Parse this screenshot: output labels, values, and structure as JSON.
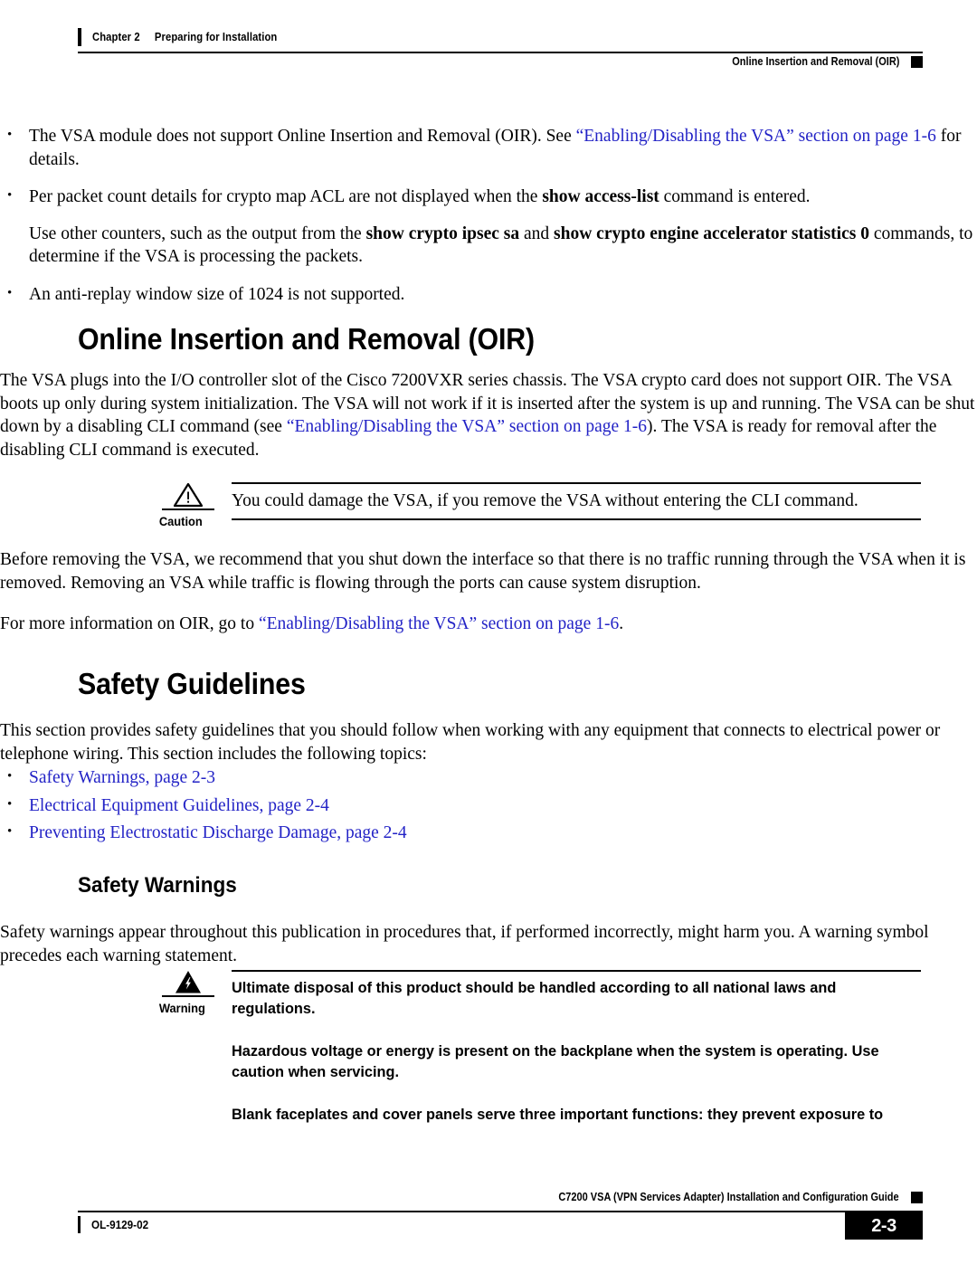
{
  "header": {
    "chapter_number": "Chapter 2",
    "chapter_title": "Preparing for Installation",
    "section_title": "Online Insertion and Removal (OIR)"
  },
  "colors": {
    "link": "#2323c6",
    "text": "#000000",
    "page_background": "#ffffff"
  },
  "intro_bullets": [
    {
      "pre": "The VSA module does not support Online Insertion and Removal (OIR). See ",
      "link": "“Enabling/Disabling the VSA” section on page 1-6",
      "post": " for details."
    }
  ],
  "bullet2": {
    "part1": "Per packet count details for crypto map ACL are not displayed when the ",
    "bold1": "show access-list",
    "part2": " command is entered.",
    "sub_part1": "Use other counters, such as the output from the ",
    "sub_bold1": "show crypto ipsec sa",
    "sub_part2": " and ",
    "sub_bold2": "show crypto engine accelerator statistics 0",
    "sub_part3": " commands, to determine if the VSA is processing the packets."
  },
  "bullet3": {
    "text": "An anti-replay window size of 1024 is not supported."
  },
  "oir_section": {
    "heading": "Online Insertion and Removal (OIR)",
    "para1_part1": "The VSA plugs into the I/O controller slot of the Cisco 7200VXR series chassis. The VSA crypto card does not support OIR. The VSA boots up only during system initialization. The VSA will not work if it is inserted after the system is up and running. The VSA can be shut down by a disabling CLI command (see ",
    "para1_link": "“Enabling/Disabling the VSA” section on page 1-6",
    "para1_part2": "). The VSA is ready for removal after the disabling CLI command is executed.",
    "caution": {
      "label": "Caution",
      "icon": "caution-triangle-icon",
      "text": "You could damage the VSA, if you remove the VSA without entering the CLI command."
    },
    "para2": "Before removing the VSA, we recommend that you shut down the interface so that there is no traffic running through the VSA when it is removed. Removing an VSA while traffic is flowing through the ports can cause system disruption.",
    "para3_part1": "For more information on OIR, go to ",
    "para3_link": "“Enabling/Disabling the VSA” section on page 1-6",
    "para3_part2": "."
  },
  "safety_section": {
    "heading": "Safety Guidelines",
    "intro": "This section provides safety guidelines that you should follow when working with any equipment that connects to electrical power or telephone wiring. This section includes the following topics:",
    "topics": [
      "Safety Warnings, page 2-3",
      "Electrical Equipment Guidelines, page 2-4",
      "Preventing Electrostatic Discharge Damage, page 2-4"
    ],
    "subheading": "Safety Warnings",
    "sub_intro": "Safety warnings appear throughout this publication in procedures that, if performed incorrectly, might harm you. A warning symbol precedes each warning statement.",
    "warning": {
      "label": "Warning",
      "icon": "warning-lightning-triangle-icon",
      "paragraphs": [
        "Ultimate disposal of this product should be handled according to all national laws and regulations.",
        "Hazardous voltage or energy is present on the backplane when the system is operating. Use caution when servicing.",
        "Blank faceplates and cover panels serve three important functions: they prevent exposure to"
      ]
    }
  },
  "footer": {
    "doc_id": "OL-9129-02",
    "guide_title": "C7200 VSA (VPN Services Adapter) Installation and Configuration Guide",
    "page_number": "2-3"
  }
}
